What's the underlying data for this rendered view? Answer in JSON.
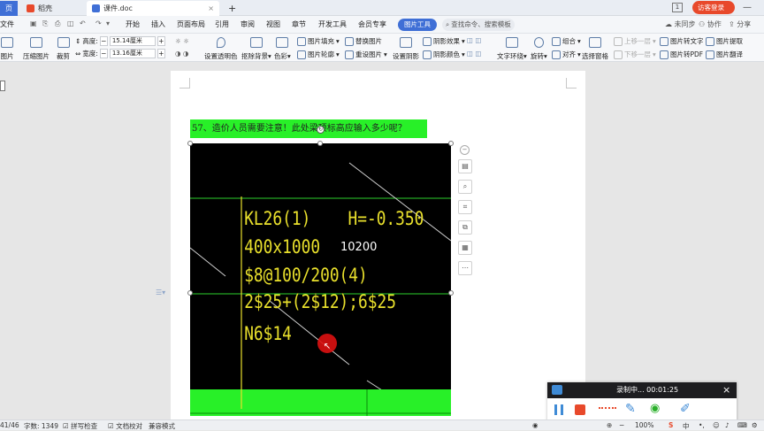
{
  "titlebar": {
    "tab_home": "页",
    "tab_daoke": "稻壳",
    "tab_doc": "课件.doc",
    "new_tab": "+",
    "badge": "1",
    "login": "访客登录"
  },
  "menubar": {
    "file": "文件",
    "items": [
      "开始",
      "插入",
      "页面布局",
      "引用",
      "审阅",
      "视图",
      "章节",
      "开发工具",
      "会员专享"
    ],
    "active_tool": "图片工具",
    "search": "查找命令、搜索模板",
    "sync": "未同步",
    "collab": "协作",
    "share": "分享"
  },
  "ribbon": {
    "left_cut": "图片",
    "compress": "压缩图片",
    "crop": "裁剪",
    "height_label": "高度:",
    "height_value": "15.14厘米",
    "width_label": "宽度:",
    "width_value": "13.16厘米",
    "transparent": "设置透明色",
    "remove_bg": "抠除背景",
    "color": "色彩",
    "fill": "图片填充",
    "outline": "图片轮廓",
    "replace": "替换图片",
    "reset": "重设图片",
    "shadow": "设置阴影",
    "shadow_effect": "阴影效果",
    "shadow_color": "阴影颜色",
    "wrap": "文字环绕",
    "rotate": "旋转",
    "group": "组合",
    "align": "对齐",
    "select_pane": "选择窗格",
    "up_layer": "上移一层",
    "down_layer": "下移一层",
    "img_to_text": "图片转文字",
    "img_to_pdf": "图片转PDF",
    "img_extract": "图片提取",
    "img_translate": "图片翻译"
  },
  "document": {
    "question": "57、造价人员需要注意！此处梁顶标高应输入多少呢？",
    "cad_lines": [
      "KL26(1)",
      "H=-0.350",
      "400x1000",
      "$8@100/200(4)",
      "2$25+(2$12);6$25",
      "N6$14"
    ],
    "cad_value": "10200"
  },
  "recorder": {
    "status": "录制中... 00:01:25",
    "close": "×",
    "ime": "中"
  },
  "statusbar": {
    "page": "41/46",
    "words": "字数: 1349",
    "spell": "拼写检查",
    "proof": "文档校对",
    "compat": "兼容模式",
    "zoom": "100%"
  },
  "colors": {
    "highlight": "#28f028",
    "cad_text": "#e9e02c",
    "cad_line": "#2bd02b",
    "accent": "#3f6fd6",
    "recorder_stop": "#e8492b"
  }
}
